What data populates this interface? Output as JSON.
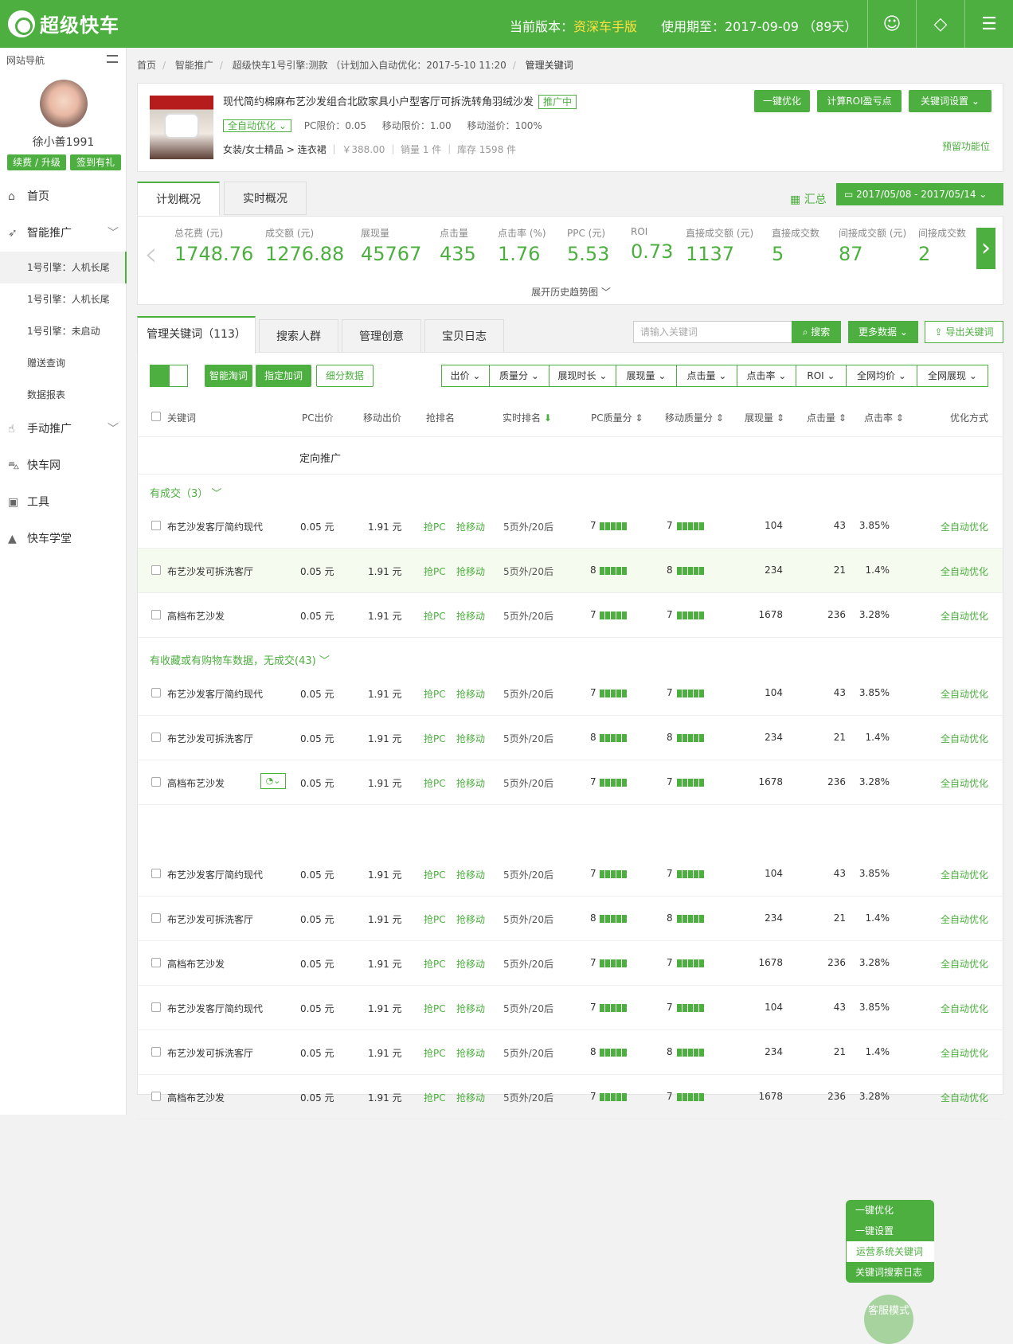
{
  "app": {
    "logo": "超级快车",
    "version_label": "当前版本：",
    "version": "资深车手版",
    "period": "使用期至：2017-09-09 （89天）"
  },
  "sidebar": {
    "title": "网站导航",
    "username": "徐小善1991",
    "btn_renew": "续费 / 升级",
    "btn_sign": "签到有礼",
    "items": [
      {
        "label": "首页",
        "icon": "home-icon"
      },
      {
        "label": "智能推广",
        "icon": "rocket-icon"
      },
      {
        "label": "手动推广",
        "icon": "hand-icon"
      },
      {
        "label": "快车网",
        "icon": "car-icon"
      },
      {
        "label": "工具",
        "icon": "toolbox-icon"
      },
      {
        "label": "快车学堂",
        "icon": "grad-cap-icon"
      }
    ],
    "subitems": [
      "1号引擎：人机长尾",
      "1号引擎：人机长尾",
      "1号引擎：未启动",
      "赠送查询",
      "数据报表"
    ]
  },
  "breadcrumb": [
    "首页",
    "智能推广",
    "超级快车1号引擎:测款 （计划加入自动优化：2017-5-10 11:20",
    "管理关键词"
  ],
  "product": {
    "title": "现代简约棉麻布艺沙发组合北欧家具小户型客厅可拆洗转角羽绒沙发",
    "status_tag": "推广中",
    "auto": "全自动优化",
    "pc_limit": "PC限价：0.05",
    "mobile_limit": "移动限价：1.00",
    "mobile_premium": "移动溢价：100%",
    "category": "女装/女士精品 > 连衣裙",
    "price": "￥388.00",
    "sales": "销量 1 件",
    "stock": "库存 1598 件",
    "btn_optimize": "一键优化",
    "btn_roi": "计算ROI盈亏点",
    "btn_kwset": "关键词设置",
    "reserve": "预留功能位"
  },
  "overview": {
    "tab1": "计划概况",
    "tab2": "实时概况",
    "summary": "汇总",
    "date": "2017/05/08 - 2017/05/14",
    "expand": "展开历史趋势图",
    "stats": [
      {
        "label": "总花费 (元)",
        "value": "1748.76"
      },
      {
        "label": "成交额 (元)",
        "value": "1276.88"
      },
      {
        "label": "展现量",
        "value": "45767"
      },
      {
        "label": "点击量",
        "value": "435"
      },
      {
        "label": "点击率 (%)",
        "value": "1.76"
      },
      {
        "label": "PPC (元)",
        "value": "5.53"
      },
      {
        "label": "ROI",
        "value": "0.73"
      },
      {
        "label": "直接成交额 (元)",
        "value": "1137"
      },
      {
        "label": "直接成交数",
        "value": "5"
      },
      {
        "label": "间接成交额 (元)",
        "value": "87"
      },
      {
        "label": "间接成交数",
        "value": "2"
      }
    ]
  },
  "kwtabs": [
    "管理关键词（113）",
    "搜索人群",
    "管理创意",
    "宝贝日志"
  ],
  "search": {
    "placeholder": "请输入关键词",
    "btn": "搜索",
    "more": "更多数据",
    "export": "导出关键词"
  },
  "toolbar": {
    "smart": "智能淘词",
    "assign": "指定加词",
    "detail": "细分数据",
    "filters": [
      "出价",
      "质量分",
      "展现时长",
      "展现量",
      "点击量",
      "点击率",
      "ROI",
      "全网均价",
      "全网展现"
    ]
  },
  "columns": [
    "关键词",
    "PC出价",
    "移动出价",
    "抢排名",
    "实时排名",
    "PC质量分",
    "移动质量分",
    "展现量",
    "点击量",
    "点击率",
    "优化方式"
  ],
  "targeting": "定向推广",
  "group1": "有成交（3）",
  "group2": "有收藏或有购物车数据，无成交(43)",
  "rows": [
    {
      "kw": "布艺沙发客厅简约现代",
      "pc": "0.05 元",
      "mob": "1.91 元",
      "grab_pc": "抢PC",
      "grab_m": "抢移动",
      "rank": "5页外/20后",
      "pcq": "7",
      "mq": "7",
      "imp": "104",
      "clk": "43",
      "ctr": "3.85%",
      "opt": "全自动优化"
    },
    {
      "kw": "布艺沙发可拆洗客厅",
      "pc": "0.05 元",
      "mob": "1.91 元",
      "grab_pc": "抢PC",
      "grab_m": "抢移动",
      "rank": "5页外/20后",
      "pcq": "8",
      "mq": "8",
      "imp": "234",
      "clk": "21",
      "ctr": "1.4%",
      "opt": "全自动优化"
    },
    {
      "kw": "高档布艺沙发",
      "pc": "0.05 元",
      "mob": "1.91 元",
      "grab_pc": "抢PC",
      "grab_m": "抢移动",
      "rank": "5页外/20后",
      "pcq": "7",
      "mq": "7",
      "imp": "1678",
      "clk": "236",
      "ctr": "3.28%",
      "opt": "全自动优化"
    },
    {
      "kw": "布艺沙发客厅简约现代",
      "pc": "0.05 元",
      "mob": "1.91 元",
      "grab_pc": "抢PC",
      "grab_m": "抢移动",
      "rank": "5页外/20后",
      "pcq": "7",
      "mq": "7",
      "imp": "104",
      "clk": "43",
      "ctr": "3.85%",
      "opt": "全自动优化"
    },
    {
      "kw": "布艺沙发可拆洗客厅",
      "pc": "0.05 元",
      "mob": "1.91 元",
      "grab_pc": "抢PC",
      "grab_m": "抢移动",
      "rank": "5页外/20后",
      "pcq": "8",
      "mq": "8",
      "imp": "234",
      "clk": "21",
      "ctr": "1.4%",
      "opt": "全自动优化"
    },
    {
      "kw": "高档布艺沙发",
      "pc": "0.05 元",
      "mob": "1.91 元",
      "grab_pc": "抢PC",
      "grab_m": "抢移动",
      "rank": "5页外/20后",
      "pcq": "7",
      "mq": "7",
      "imp": "1678",
      "clk": "236",
      "ctr": "3.28%",
      "opt": "全自动优化"
    },
    {
      "kw": "布艺沙发客厅简约现代",
      "pc": "0.05 元",
      "mob": "1.91 元",
      "grab_pc": "抢PC",
      "grab_m": "抢移动",
      "rank": "5页外/20后",
      "pcq": "7",
      "mq": "7",
      "imp": "104",
      "clk": "43",
      "ctr": "3.85%",
      "opt": "全自动优化"
    },
    {
      "kw": "布艺沙发可拆洗客厅",
      "pc": "0.05 元",
      "mob": "1.91 元",
      "grab_pc": "抢PC",
      "grab_m": "抢移动",
      "rank": "5页外/20后",
      "pcq": "8",
      "mq": "8",
      "imp": "234",
      "clk": "21",
      "ctr": "1.4%",
      "opt": "全自动优化"
    },
    {
      "kw": "高档布艺沙发",
      "pc": "0.05 元",
      "mob": "1.91 元",
      "grab_pc": "抢PC",
      "grab_m": "抢移动",
      "rank": "5页外/20后",
      "pcq": "7",
      "mq": "7",
      "imp": "1678",
      "clk": "236",
      "ctr": "3.28%",
      "opt": "全自动优化"
    },
    {
      "kw": "布艺沙发客厅简约现代",
      "pc": "0.05 元",
      "mob": "1.91 元",
      "grab_pc": "抢PC",
      "grab_m": "抢移动",
      "rank": "5页外/20后",
      "pcq": "7",
      "mq": "7",
      "imp": "104",
      "clk": "43",
      "ctr": "3.85%",
      "opt": "全自动优化"
    },
    {
      "kw": "布艺沙发可拆洗客厅",
      "pc": "0.05 元",
      "mob": "1.91 元",
      "grab_pc": "抢PC",
      "grab_m": "抢移动",
      "rank": "5页外/20后",
      "pcq": "8",
      "mq": "8",
      "imp": "234",
      "clk": "21",
      "ctr": "1.4%",
      "opt": "全自动优化"
    },
    {
      "kw": "高档布艺沙发",
      "pc": "0.05 元",
      "mob": "1.91 元",
      "grab_pc": "抢PC",
      "grab_m": "抢移动",
      "rank": "5页外/20后",
      "pcq": "7",
      "mq": "7",
      "imp": "1678",
      "clk": "236",
      "ctr": "3.28%",
      "opt": "全自动优化"
    }
  ],
  "popup": [
    "一键优化",
    "一键设置",
    "运营系统关键词",
    "关键词搜索日志"
  ],
  "float_btn": "客服模式",
  "colors": {
    "accent": "#4caf3f",
    "version": "#ffe040"
  }
}
